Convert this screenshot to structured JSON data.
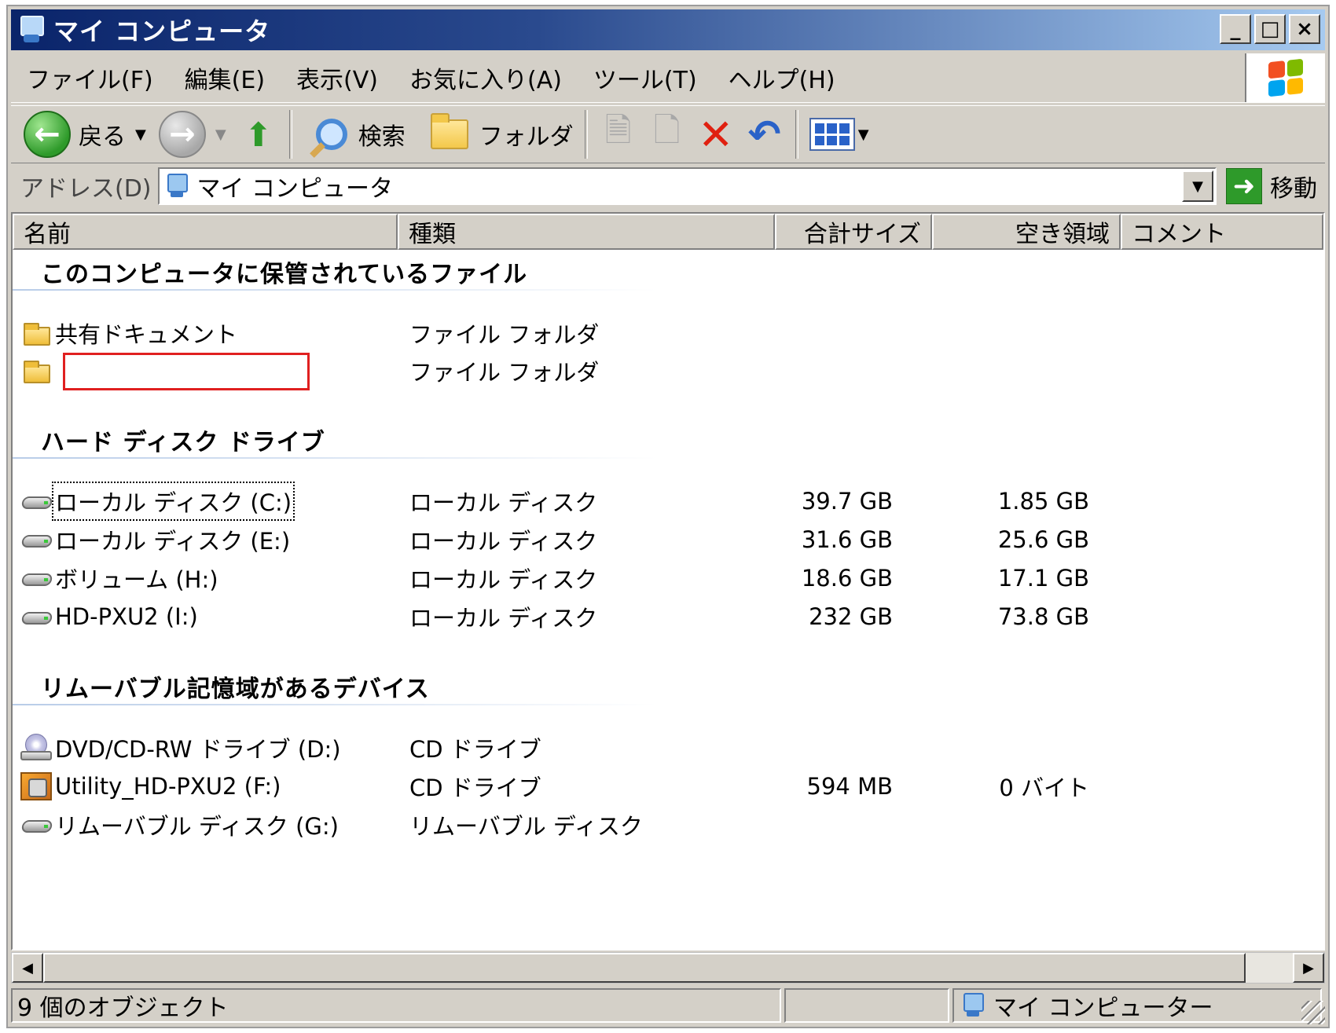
{
  "window": {
    "title": "マイ コンピュータ"
  },
  "title_buttons": {
    "minimize": "_",
    "maximize": "□",
    "close": "×"
  },
  "menu": [
    "ファイル(F)",
    "編集(E)",
    "表示(V)",
    "お気に入り(A)",
    "ツール(T)",
    "ヘルプ(H)"
  ],
  "toolbar": {
    "back": "戻る",
    "search": "検索",
    "folders": "フォルダ"
  },
  "address": {
    "label": "アドレス(D)",
    "value": "マイ コンピュータ",
    "go": "移動"
  },
  "columns": {
    "name": "名前",
    "type": "種類",
    "total": "合計サイズ",
    "free": "空き領域",
    "comment": "コメント"
  },
  "groups": [
    {
      "title": "このコンピュータに保管されているファイル",
      "items": [
        {
          "name": "共有ドキュメント",
          "type": "ファイル フォルダ",
          "icon": "folder-icon"
        },
        {
          "name": "",
          "type": "ファイル フォルダ",
          "icon": "folder-icon",
          "redacted": true
        }
      ]
    },
    {
      "title": "ハード ディスク ドライブ",
      "items": [
        {
          "name": "ローカル ディスク (C:)",
          "type": "ローカル ディスク",
          "total": "39.7 GB",
          "free": "1.85 GB",
          "icon": "hard-drive-icon"
        },
        {
          "name": "ローカル ディスク (E:)",
          "type": "ローカル ディスク",
          "total": "31.6 GB",
          "free": "25.6 GB",
          "icon": "hard-drive-icon"
        },
        {
          "name": "ボリューム (H:)",
          "type": "ローカル ディスク",
          "total": "18.6 GB",
          "free": "17.1 GB",
          "icon": "hard-drive-icon"
        },
        {
          "name": "HD-PXU2 (I:)",
          "type": "ローカル ディスク",
          "total": "232 GB",
          "free": "73.8 GB",
          "icon": "hard-drive-icon"
        }
      ]
    },
    {
      "title": "リムーバブル記憶域があるデバイス",
      "items": [
        {
          "name": "DVD/CD-RW ドライブ (D:)",
          "type": "CD ドライブ",
          "icon": "cd-drive-icon"
        },
        {
          "name": "Utility_HD-PXU2 (F:)",
          "type": "CD ドライブ",
          "total": "594 MB",
          "free": "0 バイト",
          "icon": "utility-drive-icon"
        },
        {
          "name": "リムーバブル ディスク (G:)",
          "type": "リムーバブル ディスク",
          "icon": "removable-disk-icon"
        }
      ]
    }
  ],
  "status": {
    "count": "9 個のオブジェクト",
    "location": "マイ コンピューター"
  },
  "colors": {
    "title_start": "#0a246a",
    "title_end": "#a6caf0",
    "face": "#d4d0c8",
    "redaction": "#e02020"
  }
}
